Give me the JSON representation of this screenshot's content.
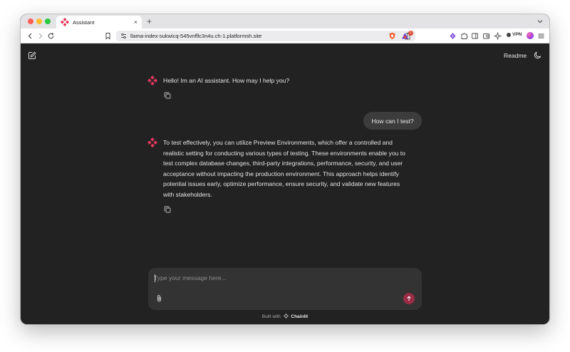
{
  "browser": {
    "tab_title": "Assistant",
    "tab_close_glyph": "×",
    "new_tab_glyph": "+",
    "url": "llama-index-sukwicq-545vnfflc3n4u.ch-1.platformsh.site",
    "shield_badge_count": "1",
    "vpn_label": "VPN",
    "traffic_lights": {
      "close": "#fe5f57",
      "minimize": "#febc2e",
      "maximize": "#28c840"
    },
    "icons": [
      "back-arrow-icon",
      "forward-arrow-icon",
      "reload-icon",
      "bookmark-icon",
      "site-settings-icon",
      "share-icon",
      "brave-shield-icon",
      "brave-rewards-icon",
      "extension-icon",
      "puzzle-icon",
      "sidebar-icon",
      "wallet-icon",
      "sparkle-icon",
      "vpn-icon",
      "menu-icon"
    ]
  },
  "header": {
    "readme_label": "Readme",
    "icons": [
      "new-chat-icon",
      "moon-icon"
    ]
  },
  "messages": [
    {
      "role": "assistant",
      "text": "Hello! Im an AI assistant. How may I help you?"
    },
    {
      "role": "user",
      "text": "How can I test?"
    },
    {
      "role": "assistant",
      "lines": [
        "To test effectively, you can utilize Preview Environments, which offer a controlled and",
        "realistic setting for conducting various types of testing. These environments enable you to",
        "test complex database changes, third-party integrations, performance, security, and user",
        "acceptance without impacting the production environment. This approach helps identify",
        "potential issues early, optimize performance, ensure security, and validate new features",
        "with stakeholders."
      ]
    }
  ],
  "composer": {
    "placeholder": "Type your message here...",
    "value": ""
  },
  "footer": {
    "prefix": "Built with",
    "brand": "Chainlit"
  },
  "colors": {
    "background": "#222222",
    "composer_bg": "#333333",
    "user_bubble_bg": "#3c3c3c",
    "accent": "#e8375e",
    "send_button": "#9a2c45"
  }
}
